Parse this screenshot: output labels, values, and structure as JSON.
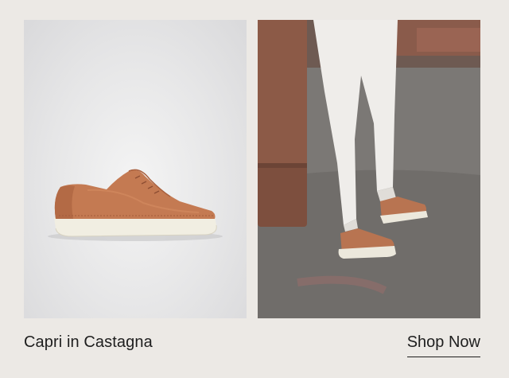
{
  "product": {
    "name": "Capri in Castagna",
    "cta_label": "Shop Now"
  },
  "images": {
    "product_shot": "shoe-product-photo",
    "lifestyle_shot": "shoe-lifestyle-photo"
  },
  "colors": {
    "background": "#ece9e5",
    "text": "#1e1e1e",
    "shoe_leather": "#c47a52",
    "sole": "#f1eee2"
  }
}
